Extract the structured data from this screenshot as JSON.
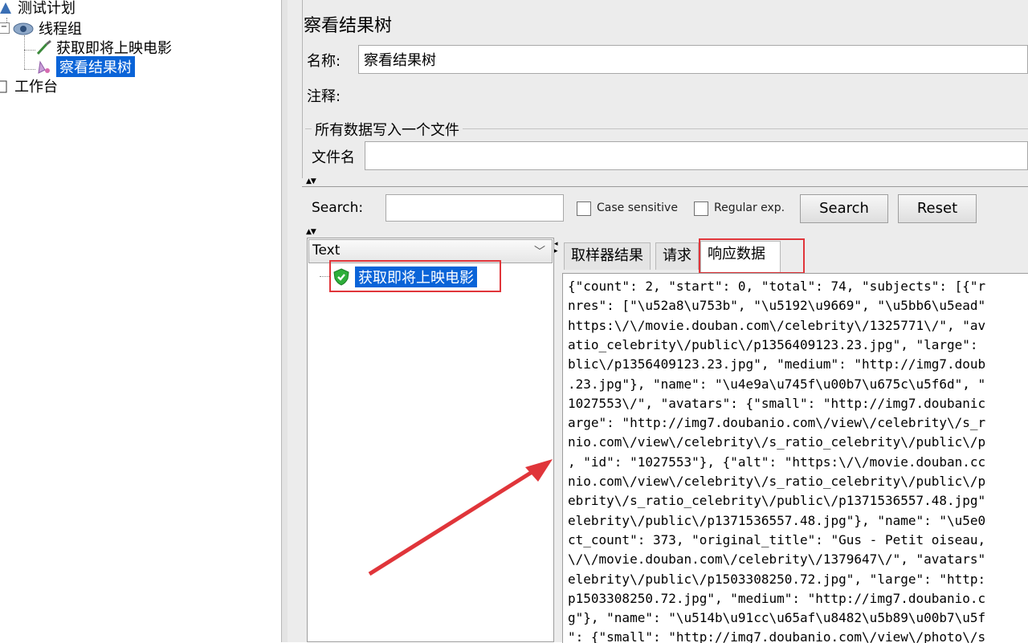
{
  "tree": {
    "test_plan": "测试计划",
    "thread_group": "线程组",
    "sampler": "获取即将上映电影",
    "listener": "察看结果树",
    "workbench": "工作台"
  },
  "panel": {
    "title": "察看结果树",
    "name_label": "名称:",
    "name_value": "察看结果树",
    "comment_label": "注释:",
    "comment_value": "",
    "group_title": "所有数据写入一个文件",
    "filename_label": "文件名",
    "filename_value": ""
  },
  "search": {
    "label": "Search:",
    "value": "",
    "case_sensitive": "Case sensitive",
    "regular_exp": "Regular exp.",
    "search_button": "Search",
    "reset_button": "Reset"
  },
  "results": {
    "renderer": "Text",
    "sample_item": "获取即将上映电影",
    "sample_status": "success"
  },
  "tabs": [
    {
      "label": "取样器结果",
      "active": false
    },
    {
      "label": "请求",
      "active": false
    },
    {
      "label": "响应数据",
      "active": true
    }
  ],
  "response_lines": [
    "{\"count\": 2, \"start\": 0, \"total\": 74, \"subjects\": [{\"r",
    "nres\": [\"\\u52a8\\u753b\", \"\\u5192\\u9669\", \"\\u5bb6\\u5ead\"",
    "https:\\/\\/movie.douban.com\\/celebrity\\/1325771\\/\", \"av",
    "atio_celebrity\\/public\\/p1356409123.23.jpg\", \"large\":",
    "blic\\/p1356409123.23.jpg\", \"medium\": \"http://img7.doub",
    ".23.jpg\"}, \"name\": \"\\u4e9a\\u745f\\u00b7\\u675c\\u5f6d\", \"",
    "1027553\\/\", \"avatars\": {\"small\": \"http://img7.doubanic",
    "arge\": \"http://img7.doubanio.com\\/view\\/celebrity\\/s_r",
    "nio.com\\/view\\/celebrity\\/s_ratio_celebrity\\/public\\/p",
    ", \"id\": \"1027553\"}, {\"alt\": \"https:\\/\\/movie.douban.cc",
    "nio.com\\/view\\/celebrity\\/s_ratio_celebrity\\/public\\/p",
    "ebrity\\/s_ratio_celebrity\\/public\\/p1371536557.48.jpg\"",
    "elebrity\\/public\\/p1371536557.48.jpg\"}, \"name\": \"\\u5e0",
    "ct_count\": 373, \"original_title\": \"Gus - Petit oiseau,",
    "\\/\\/movie.douban.com\\/celebrity\\/1379647\\/\", \"avatars\"",
    "elebrity\\/public\\/p1503308250.72.jpg\", \"large\": \"http:",
    "p1503308250.72.jpg\", \"medium\": \"http://img7.doubanio.c",
    "g\"}, \"name\": \"\\u514b\\u91cc\\u65af\\u8482\\u5b89\\u00b7\\u5f",
    "\": {\"small\": \"http://img7.doubanio.com\\/view\\/photo\\/s"
  ],
  "colors": {
    "selection": "#0a64d8",
    "annotation": "#e0353a",
    "panel_bg": "#ececec"
  }
}
